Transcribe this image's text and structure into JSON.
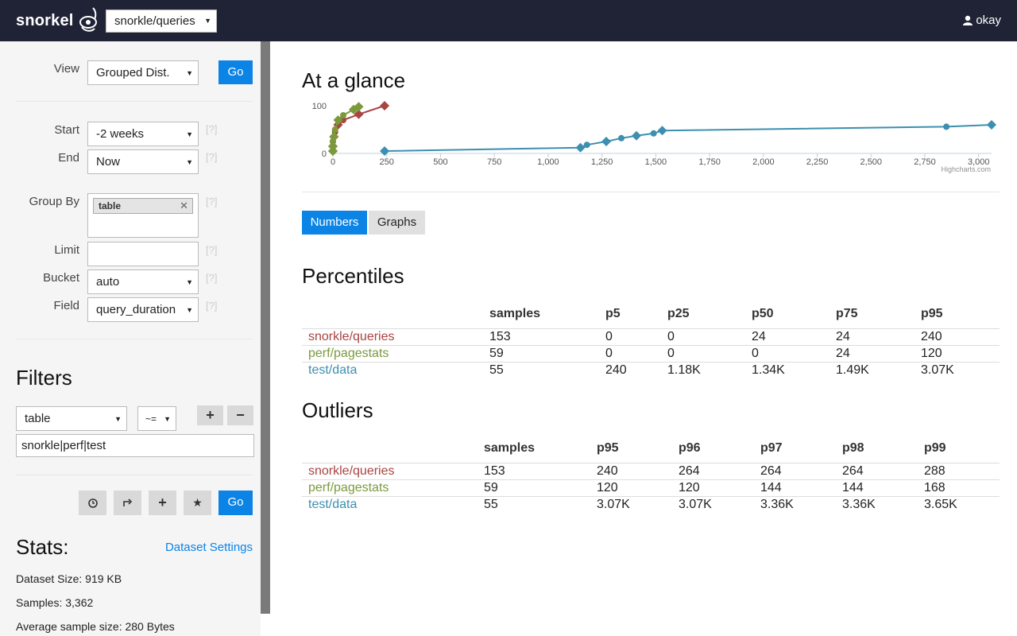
{
  "brand": "snorkel",
  "dataset_selector": "snorkle/queries",
  "user": "okay",
  "sidebar": {
    "view_label": "View",
    "view_value": "Grouped Dist.",
    "go_label": "Go",
    "start_label": "Start",
    "start_value": "-2 weeks",
    "end_label": "End",
    "end_value": "Now",
    "groupby_label": "Group By",
    "groupby_tag": "table",
    "limit_label": "Limit",
    "limit_value": "",
    "bucket_label": "Bucket",
    "bucket_value": "auto",
    "field_label": "Field",
    "field_value": "query_duration",
    "help": "[?]",
    "filters_title": "Filters",
    "filter_field": "table",
    "filter_op": "~=",
    "filter_value": "snorkle|perf|test",
    "add_label": "+",
    "remove_label": "−",
    "go2_label": "Go",
    "stats_title": "Stats:",
    "dataset_settings": "Dataset Settings",
    "stats": {
      "size": "Dataset Size: 919 KB",
      "samples": "Samples: 3,362",
      "avg": "Average sample size: 280 Bytes"
    }
  },
  "main": {
    "title": "At a glance",
    "tabs": [
      "Numbers",
      "Graphs"
    ],
    "percentiles_title": "Percentiles",
    "outliers_title": "Outliers",
    "percentiles": {
      "headers": [
        "samples",
        "p5",
        "p25",
        "p50",
        "p75",
        "p95"
      ],
      "rows": [
        {
          "name": "snorkle/queries",
          "color": "#a94442",
          "values": [
            "153",
            "0",
            "0",
            "24",
            "24",
            "240"
          ]
        },
        {
          "name": "perf/pagestats",
          "color": "#7a9a3c",
          "values": [
            "59",
            "0",
            "0",
            "0",
            "24",
            "120"
          ]
        },
        {
          "name": "test/data",
          "color": "#3c8fb0",
          "values": [
            "55",
            "240",
            "1.18K",
            "1.34K",
            "1.49K",
            "3.07K"
          ]
        }
      ]
    },
    "outliers": {
      "headers": [
        "samples",
        "p95",
        "p96",
        "p97",
        "p98",
        "p99"
      ],
      "rows": [
        {
          "name": "snorkle/queries",
          "color": "#a94442",
          "values": [
            "153",
            "240",
            "264",
            "264",
            "264",
            "288"
          ]
        },
        {
          "name": "perf/pagestats",
          "color": "#7a9a3c",
          "values": [
            "59",
            "120",
            "120",
            "144",
            "144",
            "168"
          ]
        },
        {
          "name": "test/data",
          "color": "#3c8fb0",
          "values": [
            "55",
            "3.07K",
            "3.07K",
            "3.36K",
            "3.36K",
            "3.65K"
          ]
        }
      ]
    }
  },
  "chart_data": {
    "type": "line",
    "credits": "Highcharts.com",
    "xlim": [
      0,
      3060
    ],
    "ylim": [
      0,
      100
    ],
    "x_ticks": [
      "0",
      "250",
      "500",
      "750",
      "1,000",
      "1,250",
      "1,500",
      "1,750",
      "2,000",
      "2,250",
      "2,500",
      "2,750",
      "3,000"
    ],
    "x_tick_values": [
      0,
      250,
      500,
      750,
      1000,
      1250,
      1500,
      1750,
      2000,
      2250,
      2500,
      2750,
      3000
    ],
    "y_ticks": [
      "0",
      "100"
    ],
    "y_tick_values": [
      0,
      100
    ],
    "series": [
      {
        "color": "#a94442",
        "points": [
          [
            0,
            5
          ],
          [
            0,
            15
          ],
          [
            0,
            25
          ],
          [
            5,
            35
          ],
          [
            10,
            45
          ],
          [
            24,
            60
          ],
          [
            48,
            70
          ],
          [
            120,
            82
          ],
          [
            240,
            100
          ]
        ]
      },
      {
        "color": "#7a9a3c",
        "points": [
          [
            0,
            5
          ],
          [
            0,
            15
          ],
          [
            0,
            25
          ],
          [
            5,
            35
          ],
          [
            10,
            50
          ],
          [
            24,
            70
          ],
          [
            48,
            80
          ],
          [
            96,
            92
          ],
          [
            120,
            98
          ]
        ]
      },
      {
        "color": "#3c8fb0",
        "points": [
          [
            240,
            5
          ],
          [
            1150,
            12
          ],
          [
            1180,
            18
          ],
          [
            1270,
            25
          ],
          [
            1340,
            32
          ],
          [
            1410,
            37
          ],
          [
            1490,
            42
          ],
          [
            1530,
            48
          ],
          [
            2850,
            56
          ],
          [
            3060,
            60
          ]
        ]
      }
    ]
  },
  "colors": {
    "accent": "#0b84e6",
    "topbar": "#1f2335"
  }
}
